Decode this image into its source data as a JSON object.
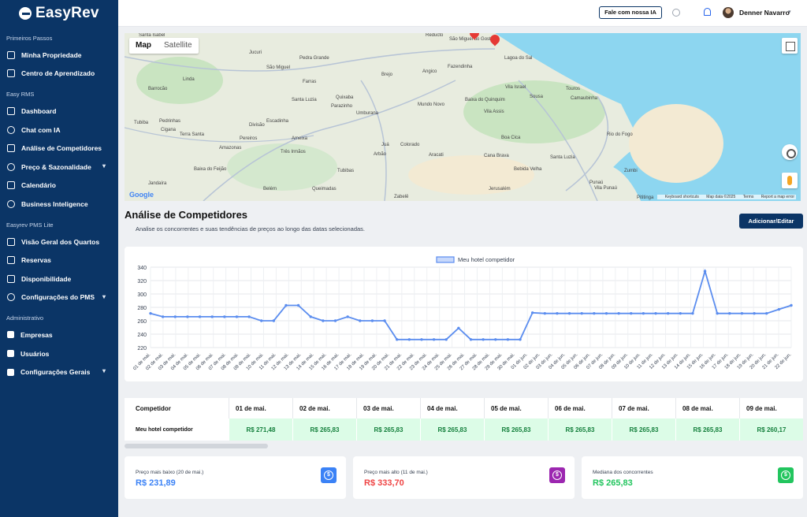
{
  "app": {
    "logo": "EasyRev"
  },
  "sidebar": {
    "sections": [
      {
        "title": "Primeiros Passos",
        "items": [
          {
            "label": "Minha Propriedade",
            "icon": "building-icon"
          },
          {
            "label": "Centro de Aprendizado",
            "icon": "book-icon"
          }
        ]
      },
      {
        "title": "Easy RMS",
        "items": [
          {
            "label": "Dashboard",
            "icon": "dashboard-icon"
          },
          {
            "label": "Chat com IA",
            "icon": "chat-icon"
          },
          {
            "label": "Análise de Competidores",
            "icon": "star-icon"
          },
          {
            "label": "Preço & Sazonalidade",
            "icon": "dollar-icon",
            "expandable": true
          },
          {
            "label": "Calendário",
            "icon": "calendar-icon"
          },
          {
            "label": "Business Inteligence",
            "icon": "location-icon"
          }
        ]
      },
      {
        "title": "Easyrev PMS Lite",
        "items": [
          {
            "label": "Visão Geral dos Quartos",
            "icon": "grid-icon"
          },
          {
            "label": "Reservas",
            "icon": "clipboard-icon"
          },
          {
            "label": "Disponibilidade",
            "icon": "calendar-icon"
          },
          {
            "label": "Configurações do PMS",
            "icon": "gear-icon",
            "expandable": true
          }
        ]
      },
      {
        "title": "Administrativo",
        "items": [
          {
            "label": "Empresas",
            "icon": "company-icon"
          },
          {
            "label": "Usuários",
            "icon": "users-icon"
          },
          {
            "label": "Configurações Gerais",
            "icon": "settings-icon",
            "expandable": true
          }
        ]
      }
    ]
  },
  "topbar": {
    "ia_button": "Fale com nossa IA",
    "user_name": "Denner Navarro"
  },
  "map": {
    "tab_map": "Map",
    "tab_satellite": "Satellite",
    "google": "Google",
    "footer": [
      "Keyboard shortcuts",
      "Map data ©2025",
      "Terms",
      "Report a map error"
    ],
    "places": [
      "Santa Isabel",
      "Jucuri",
      "Pedra Grande",
      "São Miguel",
      "Reducto",
      "São Miguel do Gostoso",
      "Lagoa do Sal",
      "Linda",
      "Farras",
      "Brejo",
      "Angico",
      "Fazendinha",
      "Barrocão",
      "Santa Luzia",
      "Quixaba",
      "Parazinho",
      "Mundo Novo",
      "Baixa do Quinquim",
      "Vila Israel",
      "Sousa",
      "Touros",
      "Camaubinha",
      "Umburana",
      "Vila Assis",
      "Tubiba",
      "Pedrinhas",
      "Cigana",
      "Escadinha",
      "Divisão",
      "Terra Santa",
      "Pereiros",
      "Ameixa",
      "Rio do Fogo",
      "Boa Cica",
      "Amazonas",
      "Juá",
      "Colorado",
      "Três Irmãos",
      "Arbão",
      "Aracati",
      "Cana Brava",
      "Santa Luzia",
      "Baixa do Feijão",
      "Tubibas",
      "Bebida Velha",
      "Jandaíra",
      "Belém",
      "Queimadas",
      "Zabelê",
      "Jerusalém",
      "Punaú",
      "Vila Punaú",
      "Zumbi",
      "Pititinga"
    ]
  },
  "page": {
    "title": "Análise de Competidores",
    "subtitle": "Analise os concorrentes e suas tendências de preços ao longo das datas selecionadas.",
    "add_button": "Adicionar/Editar"
  },
  "chart_data": {
    "type": "line",
    "legend": "Meu hotel competidor",
    "ylim": [
      220,
      340
    ],
    "yticks": [
      220,
      240,
      260,
      280,
      300,
      320,
      340
    ],
    "color": "#5b8def",
    "x": [
      "01 de mai.",
      "02 de mai.",
      "03 de mai.",
      "04 de mai.",
      "05 de mai.",
      "06 de mai.",
      "07 de mai.",
      "08 de mai.",
      "09 de mai.",
      "10 de mai.",
      "11 de mai.",
      "12 de mai.",
      "13 de mai.",
      "14 de mai.",
      "15 de mai.",
      "16 de mai.",
      "17 de mai.",
      "18 de mai.",
      "19 de mai.",
      "20 de mai.",
      "21 de mai.",
      "22 de mai.",
      "23 de mai.",
      "24 de mai.",
      "25 de mai.",
      "26 de mai.",
      "27 de mai.",
      "28 de mai.",
      "29 de mai.",
      "30 de mai.",
      "01 de jun.",
      "02 de jun.",
      "03 de jun.",
      "04 de jun.",
      "05 de jun.",
      "06 de jun.",
      "07 de jun.",
      "08 de jun.",
      "09 de jun.",
      "10 de jun.",
      "11 de jun.",
      "12 de jun.",
      "13 de jun.",
      "14 de jun.",
      "15 de jun.",
      "16 de jun.",
      "17 de jun.",
      "18 de jun.",
      "19 de jun.",
      "20 de jun.",
      "21 de jun.",
      "22 de jun."
    ],
    "values": [
      271,
      266,
      266,
      266,
      266,
      266,
      266,
      266,
      266,
      260,
      260,
      283,
      283,
      266,
      260,
      260,
      266,
      260,
      260,
      260,
      232,
      232,
      232,
      232,
      232,
      249,
      232,
      232,
      232,
      232,
      232,
      272,
      271,
      271,
      271,
      271,
      271,
      271,
      271,
      271,
      271,
      271,
      271,
      271,
      271,
      334,
      271,
      271,
      271,
      271,
      271,
      277,
      283
    ]
  },
  "table": {
    "header_first": "Competidor",
    "days": [
      "01 de mai.",
      "02 de mai.",
      "03 de mai.",
      "04 de mai.",
      "05 de mai.",
      "06 de mai.",
      "07 de mai.",
      "08 de mai.",
      "09 de mai."
    ],
    "row_label": "Meu hotel competidor",
    "values": [
      "R$ 271,48",
      "R$ 265,83",
      "R$ 265,83",
      "R$ 265,83",
      "R$ 265,83",
      "R$ 265,83",
      "R$ 265,83",
      "R$ 265,83",
      "R$ 260,17"
    ]
  },
  "stats": [
    {
      "label": "Preço mais baixo (20 de mai.)",
      "value": "R$ 231,89",
      "color": "#3b82f6",
      "icon_color": "#3b82f6"
    },
    {
      "label": "Preço mais alto (11 de mai.)",
      "value": "R$ 333,70",
      "color": "#ef4444",
      "icon_color": "#9c27b0"
    },
    {
      "label": "Mediana dos concorrentes",
      "value": "R$ 265,83",
      "color": "#22c55e",
      "icon_color": "#22c55e"
    }
  ]
}
